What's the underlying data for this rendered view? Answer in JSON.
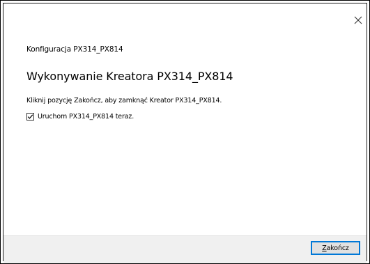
{
  "window": {
    "close_icon": "close-icon"
  },
  "content": {
    "wizard_name": "Konfiguracja PX314_PX814",
    "heading": "Wykonywanie Kreatora PX314_PX814",
    "description": "Kliknij pozycję Zakończ, aby zamknąć Kreator PX314_PX814.",
    "launch_checkbox": {
      "label": "Uruchom PX314_PX814 teraz.",
      "checked": true
    }
  },
  "footer": {
    "finish_button": {
      "accelerator": "Z",
      "rest": "akończ"
    }
  },
  "colors": {
    "focus_border": "#0078d7",
    "footer_background": "#f0f0f0"
  }
}
